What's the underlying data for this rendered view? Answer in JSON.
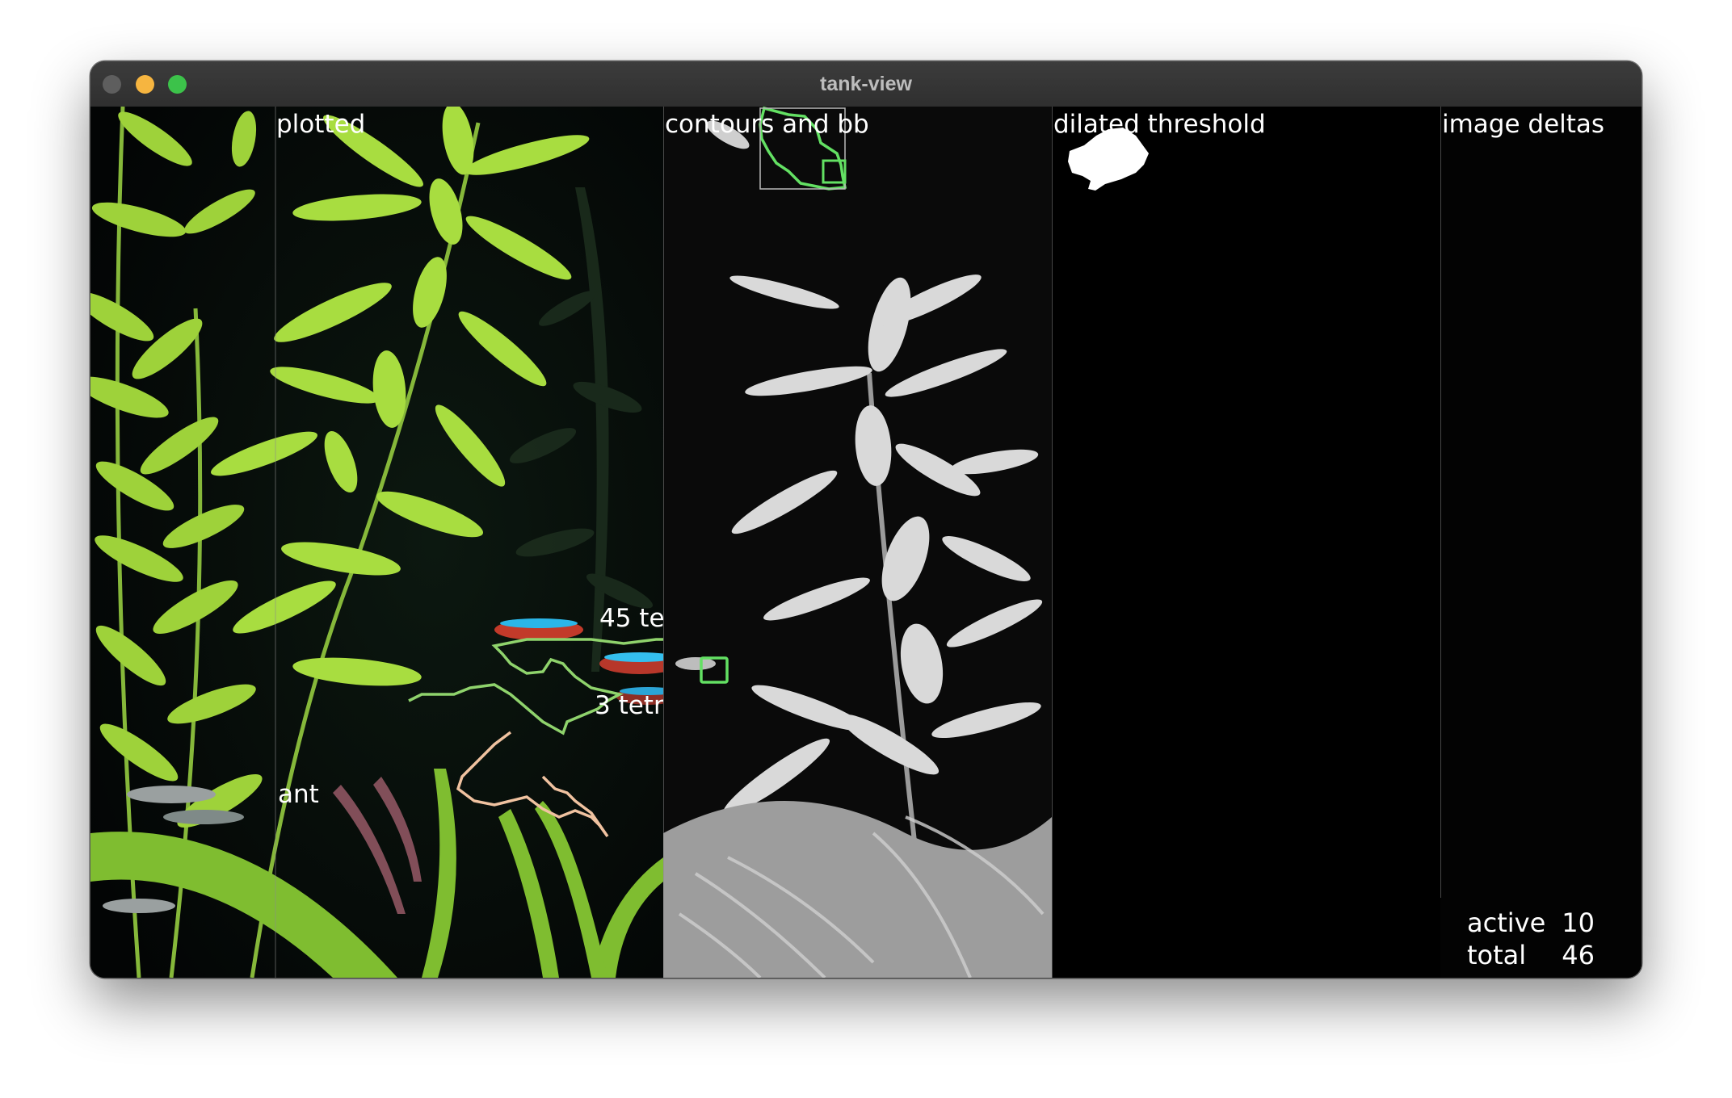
{
  "window": {
    "title": "tank-view"
  },
  "panels": {
    "plotted": {
      "label": "plotted"
    },
    "contours": {
      "label": "contours and bb"
    },
    "threshold": {
      "label": "dilated threshold"
    },
    "deltas": {
      "label": "image deltas"
    }
  },
  "track_labels": {
    "left_cut": "ant",
    "upper": "45 te",
    "lower": "3 tetr"
  },
  "stats": {
    "active_label": "active",
    "active_value": "10",
    "total_label": "total",
    "total_value": "46"
  },
  "colors": {
    "track_green": "#8fd36c",
    "track_peach": "#f0c2a0",
    "box_green": "#63e063",
    "plant_green": "#a6dd3a"
  }
}
